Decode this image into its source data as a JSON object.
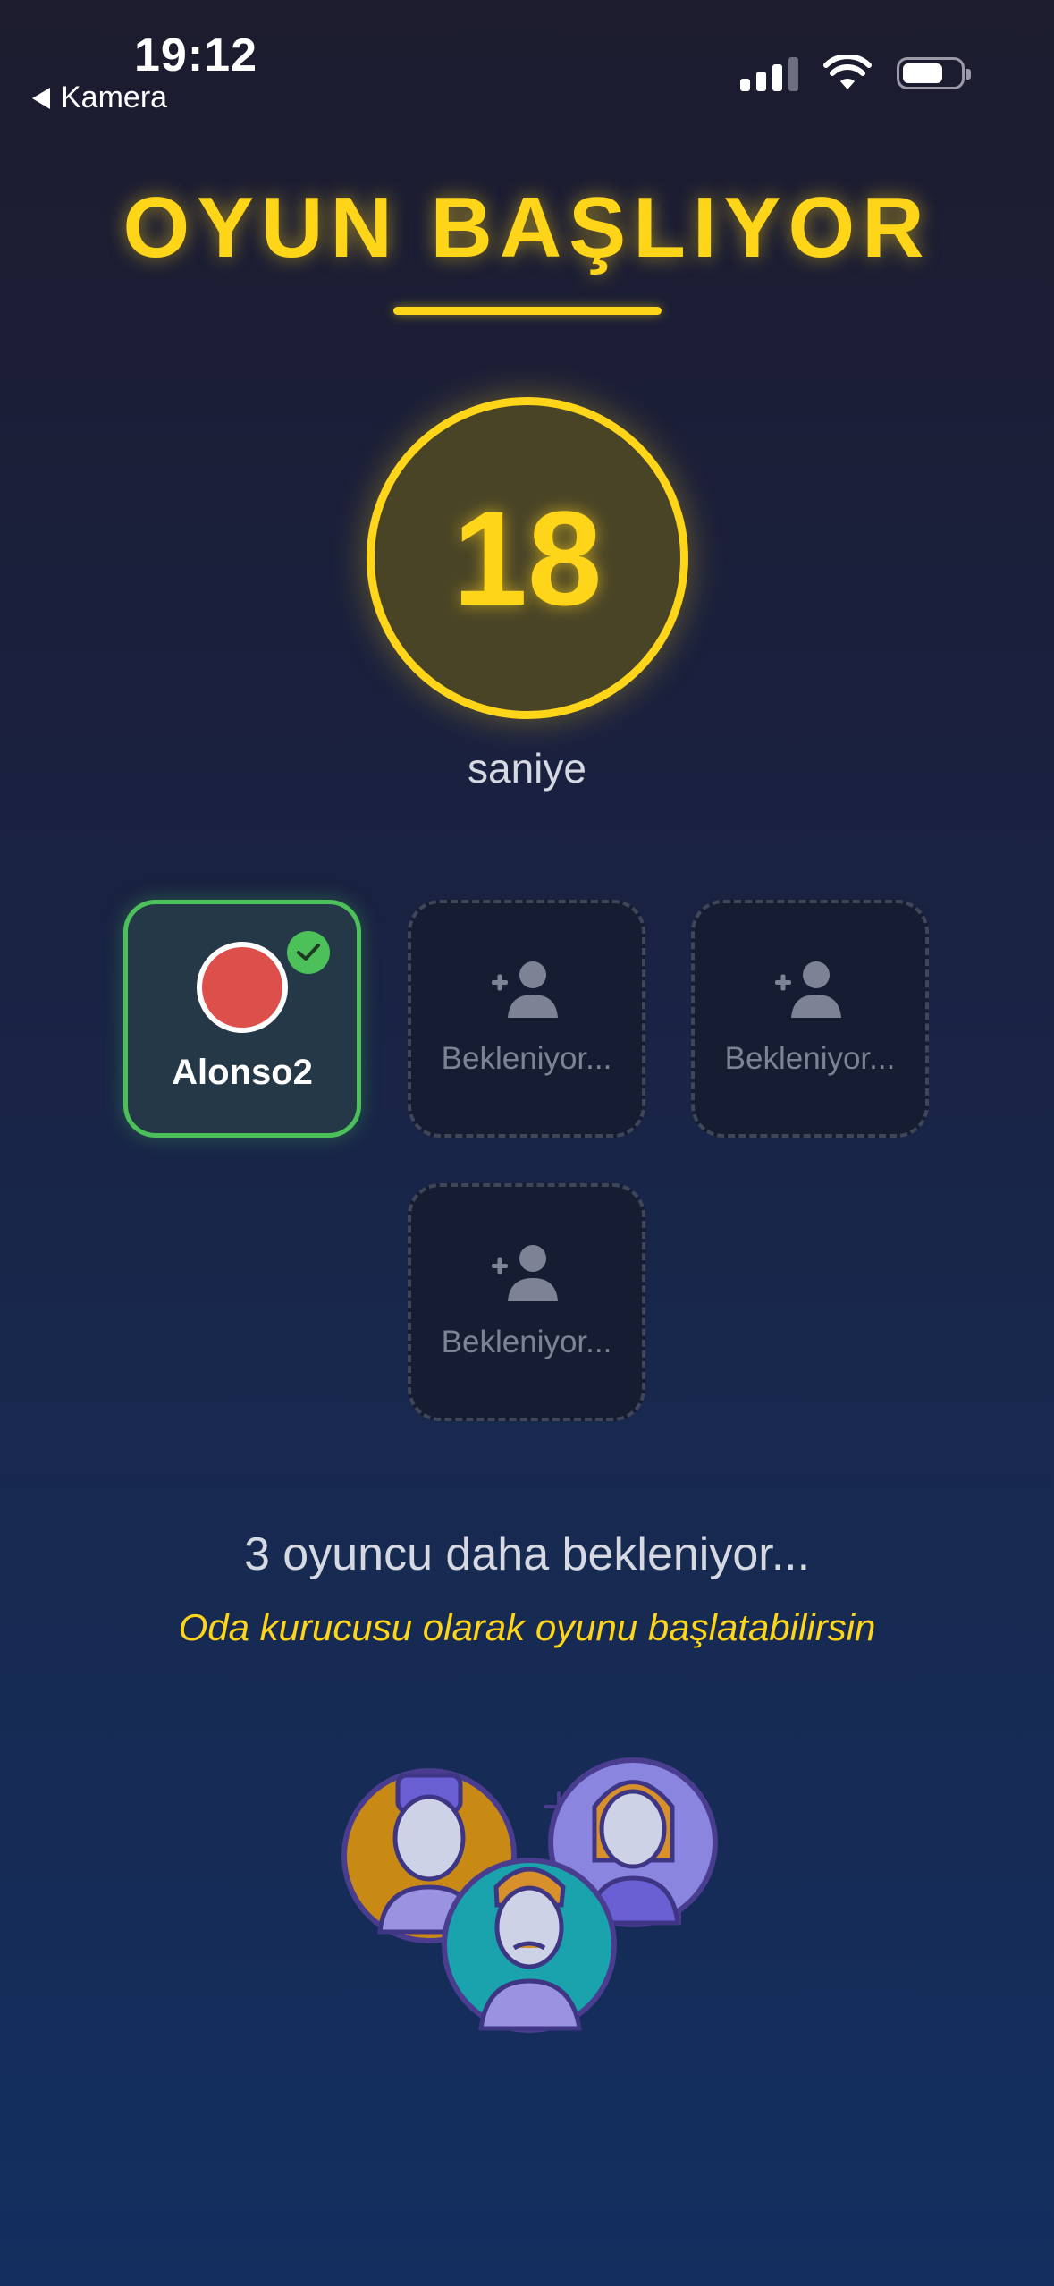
{
  "status_bar": {
    "time": "19:12",
    "back_label": "Kamera",
    "icons": [
      "signal-icon",
      "wifi-icon",
      "battery-icon"
    ]
  },
  "header": {
    "title": "OYUN BAŞLIYOR"
  },
  "countdown": {
    "value": "18",
    "unit": "saniye"
  },
  "players": [
    {
      "name": "Alonso2",
      "status": "ready",
      "avatar_color": "#dd4f4b"
    },
    {
      "label": "Bekleniyor...",
      "status": "waiting"
    },
    {
      "label": "Bekleniyor...",
      "status": "waiting"
    },
    {
      "label": "Bekleniyor...",
      "status": "waiting"
    }
  ],
  "footer": {
    "waiting_text": "3 oyuncu daha bekleniyor...",
    "hint_text": "Oda kurucusu olarak oyunu başlatabilirsin"
  },
  "colors": {
    "accent": "#ffd51a",
    "ready": "#4cc15a",
    "background_top": "#1c1c2e",
    "background_bottom": "#132f5f"
  }
}
